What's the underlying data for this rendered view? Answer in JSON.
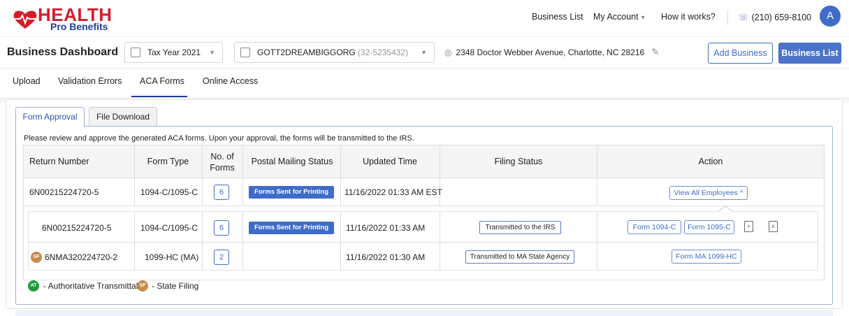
{
  "brand": {
    "name_main": "HEALTH",
    "name_sub": "Pro Benefits",
    "primary_color": "#d21e2b",
    "secondary_color": "#1f3c9b"
  },
  "topnav": {
    "business_list": "Business List",
    "my_account": "My Account",
    "how_it_works": "How it works?",
    "phone": "(210) 659-8100",
    "avatar_initial": "A"
  },
  "dashboard": {
    "title": "Business Dashboard",
    "tax_year": "Tax Year 2021",
    "business_name": "GOTT2DREAMBIGGORG",
    "business_ein": "(32-5235432)",
    "address": "2348 Doctor Webber Avenue, Charlotte, NC 28216",
    "add_business": "Add Business",
    "business_list": "Business List"
  },
  "main_tabs": [
    "Upload",
    "Validation Errors",
    "ACA Forms",
    "Online Access"
  ],
  "active_main_tab": "ACA Forms",
  "sub_tabs": [
    "Form Approval",
    "File Download"
  ],
  "active_sub_tab": "Form Approval",
  "notice": "Please review and approve the generated ACA forms. Upon your approval, the forms will be transmitted to the IRS.",
  "table": {
    "headers": [
      "Return Number",
      "Form Type",
      "No. of Forms",
      "Postal Mailing Status",
      "Updated Time",
      "Filing Status",
      "Action"
    ],
    "main_row": {
      "return_number": "6N00215224720-5",
      "form_type": "1094-C/1095-C",
      "count": "6",
      "postal_status": "Forms Sent for Printing",
      "updated": "11/16/2022 01:33 AM EST",
      "action": "View All Employees"
    },
    "sub_rows": [
      {
        "return_number": "6N00215224720-5",
        "form_type": "1094-C/1095-C",
        "count": "6",
        "postal_status": "Forms Sent for Printing",
        "updated": "11/16/2022 01:33 AM",
        "filing_status": "Transmitted to the IRS",
        "actions": [
          "Form 1094-C",
          "Form 1095-C"
        ]
      },
      {
        "badge": "SF",
        "return_number": "6NMA320224720-2",
        "form_type": "1099-HC (MA)",
        "count": "2",
        "updated": "11/16/2022 01:30 AM",
        "filing_status": "Transmitted to MA State Agency",
        "actions": [
          "Form MA 1099-HC"
        ]
      }
    ]
  },
  "legend": [
    {
      "badge": "AT",
      "label": "- Authoritative Transmittal",
      "color": "#1f9b3a"
    },
    {
      "badge": "SF",
      "label": "- State Filing",
      "color": "#c98a4e"
    }
  ]
}
